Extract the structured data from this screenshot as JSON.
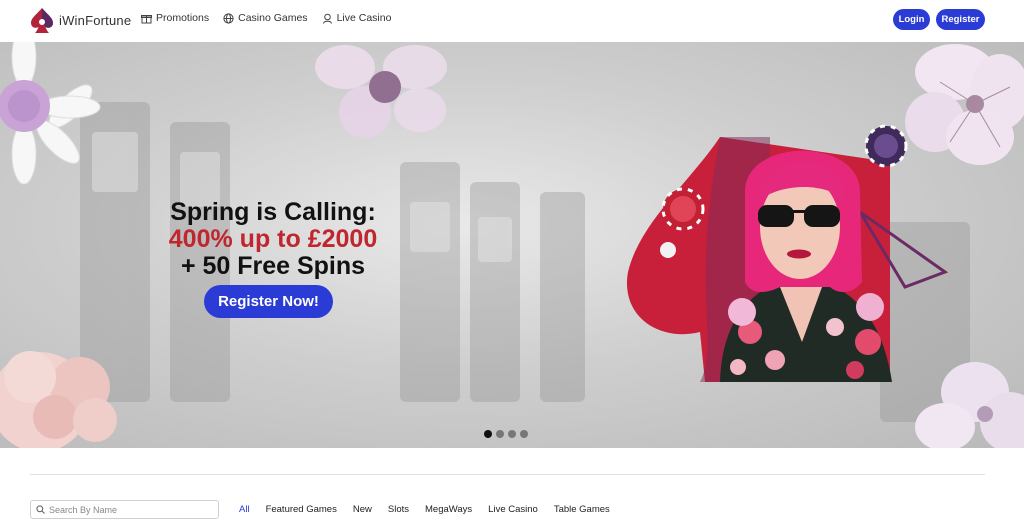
{
  "header": {
    "logo_text": "iWinFortune",
    "nav": [
      {
        "label": "Promotions",
        "icon": "gift-icon"
      },
      {
        "label": "Casino Games",
        "icon": "globe-icon"
      },
      {
        "label": "Live Casino",
        "icon": "dealer-icon"
      }
    ],
    "login_label": "Login",
    "register_label": "Register"
  },
  "hero": {
    "line1": "Spring is Calling:",
    "line2": "400% up to £2000",
    "line3": "+ 50 Free Spins",
    "cta_label": "Register Now!",
    "slides_count": 4,
    "active_slide": 1
  },
  "games": {
    "search_placeholder": "Search By Name",
    "filters": [
      "All",
      "Featured Games",
      "New",
      "Slots",
      "MegaWays",
      "Live Casino",
      "Table Games"
    ],
    "active_filter": "All"
  },
  "colors": {
    "accent": "#2b3bd6",
    "promo_red": "#c0262d"
  }
}
